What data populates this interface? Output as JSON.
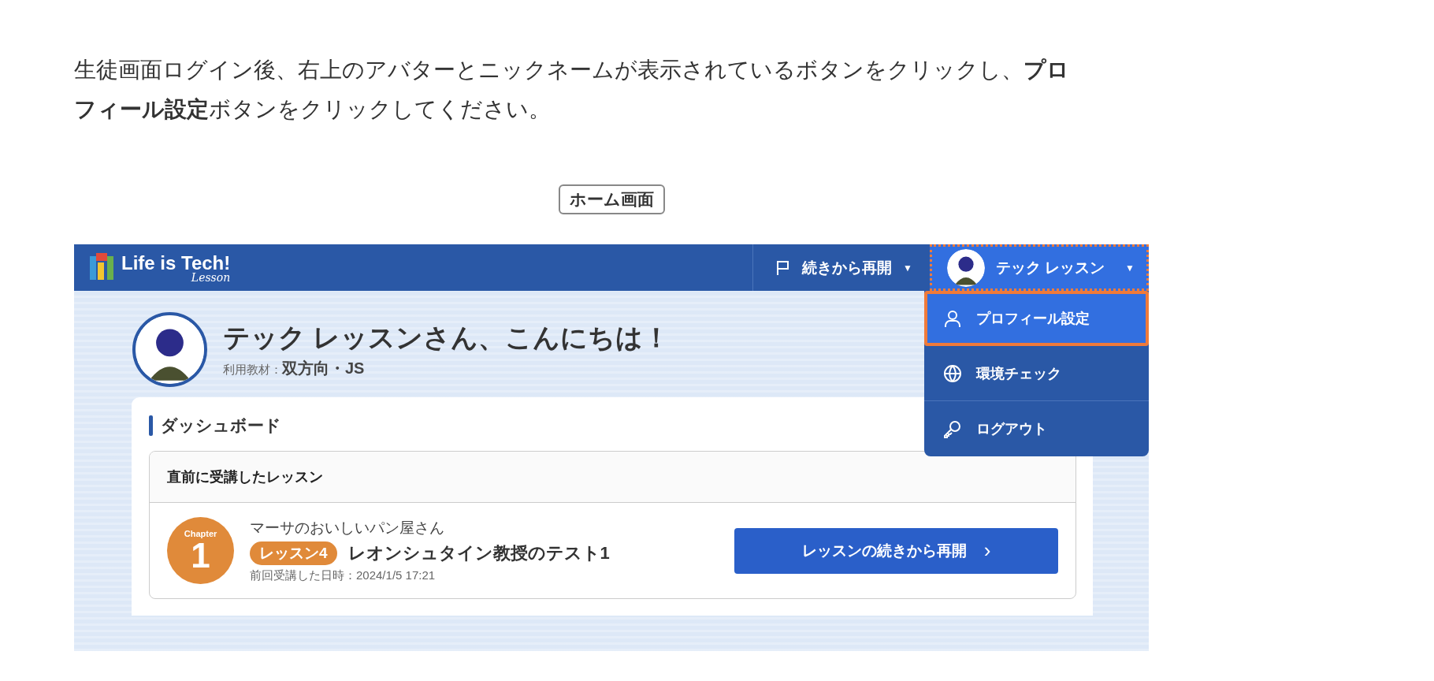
{
  "instructions": "生徒画面ログイン後、右上のアバターとニックネームが表示されているボタンをクリックし、**プロフィール設定**ボタンをクリックしてください。",
  "caption": "ホーム画面",
  "app": {
    "header": {
      "logo": {
        "title": "Life is Tech!",
        "subtitle": "Lesson"
      },
      "resume_menu": {
        "label": "続きから再開",
        "caret": "▼"
      },
      "user_button": {
        "name": "テック レッスン",
        "caret": "▼",
        "highlighted": true
      }
    },
    "user_menu": [
      {
        "kind": "profile",
        "label": "プロフィール設定",
        "selected": true
      },
      {
        "kind": "network",
        "label": "環境チェック",
        "selected": false
      },
      {
        "kind": "logout",
        "label": "ログアウト",
        "selected": false
      }
    ],
    "greeting": {
      "title": "テック レッスンさん、こんにちは！",
      "material_label": "利用教材：",
      "material": "双方向・JS"
    },
    "dashboard": {
      "title": "ダッシュボード",
      "recent_lesson": {
        "heading": "直前に受講したレッスン",
        "chapter_label": "Chapter",
        "chapter_number": "1",
        "course": "マーサのおいしいパン屋さん",
        "lesson_tag": "レッスン4",
        "lesson_title": "レオンシュタイン教授のテスト1",
        "last_viewed": "前回受講した日時：2024/1/5 17:21",
        "button": "レッスンの続きから再開",
        "button_icon": "›"
      }
    }
  }
}
